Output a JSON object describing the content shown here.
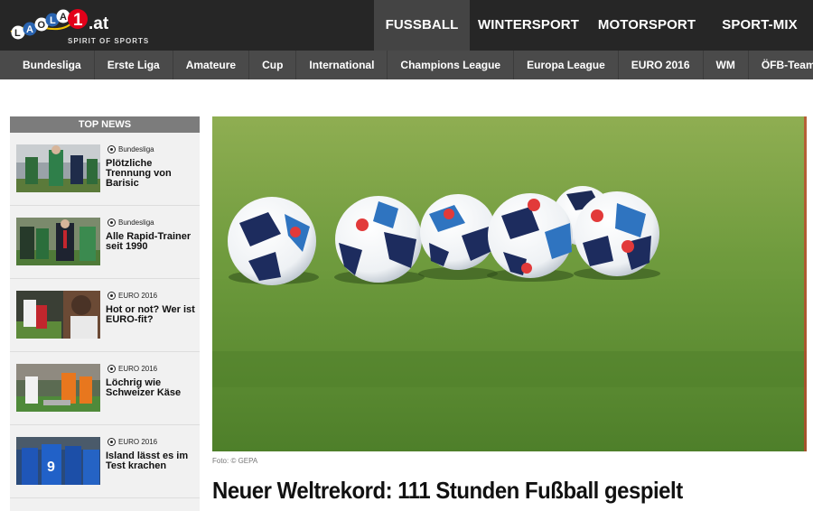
{
  "brand": {
    "tagline": "SPIRIT OF SPORTS"
  },
  "main_nav": [
    {
      "label": "FUSSBALL",
      "active": true
    },
    {
      "label": "WINTERSPORT",
      "active": false
    },
    {
      "label": "MOTORSPORT",
      "active": false
    },
    {
      "label": "SPORT-MIX",
      "active": false
    }
  ],
  "sub_nav": [
    "Bundesliga",
    "Erste Liga",
    "Amateure",
    "Cup",
    "International",
    "Champions League",
    "Europa League",
    "EURO 2016",
    "WM",
    "ÖFB-Team"
  ],
  "top_news": {
    "title": "TOP NEWS",
    "items": [
      {
        "category": "Bundesliga",
        "headline": "Plötzliche Trennung von Barisic"
      },
      {
        "category": "Bundesliga",
        "headline": "Alle Rapid-Trainer seit 1990"
      },
      {
        "category": "EURO 2016",
        "headline": "Hot or not? Wer ist EURO-fit?"
      },
      {
        "category": "EURO 2016",
        "headline": "Löchrig wie Schweizer Käse"
      },
      {
        "category": "EURO 2016",
        "headline": "Island lässt es im Test krachen"
      }
    ]
  },
  "hero": {
    "credit": "Foto: © GEPA",
    "headline": "Neuer Weltrekord: 111 Stunden Fußball gespielt"
  },
  "colors": {
    "header_bg": "#262626",
    "subnav_bg": "#4a4a4a",
    "logo_red": "#e2001a"
  }
}
